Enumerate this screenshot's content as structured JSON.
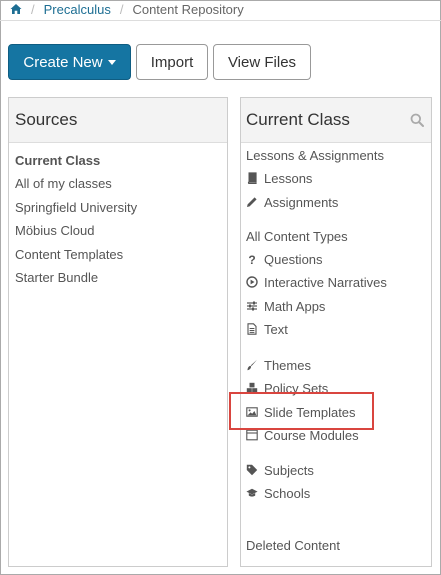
{
  "breadcrumb": {
    "home_icon": "home-icon",
    "items": [
      "Precalculus",
      "Content Repository"
    ]
  },
  "toolbar": {
    "create_new_label": "Create New",
    "import_label": "Import",
    "view_files_label": "View Files"
  },
  "sources": {
    "title": "Sources",
    "items": [
      "Current Class",
      "All of my classes",
      "Springfield University",
      "Möbius Cloud",
      "Content Templates",
      "Starter Bundle"
    ]
  },
  "current_class": {
    "title": "Current Class",
    "search_icon": "search-icon",
    "section1_header": "Lessons & Assignments",
    "lessons": "Lessons",
    "assignments": "Assignments",
    "section2_header": "All Content Types",
    "questions": "Questions",
    "interactive_narratives": "Interactive Narratives",
    "math_apps": "Math Apps",
    "text": "Text",
    "themes": "Themes",
    "policy_sets": "Policy Sets",
    "slide_templates": "Slide Templates",
    "course_modules": "Course Modules",
    "subjects": "Subjects",
    "schools": "Schools",
    "deleted_content": "Deleted Content"
  },
  "colors": {
    "primary": "#1575a2",
    "link": "#1d6e93",
    "highlight": "#d9453f"
  }
}
